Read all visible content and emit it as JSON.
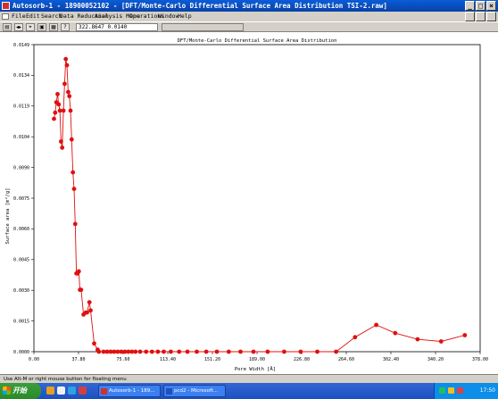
{
  "window": {
    "title": "Autosorb-1 - 18900052102 - [DFT/Monte-Carlo Differential Surface Area Distribution TSI-2.raw]",
    "controls": {
      "minimize": "_",
      "maximize": "□",
      "close": "×"
    }
  },
  "menu": {
    "items": [
      "File",
      "Edit",
      "Search",
      "Data Reduction",
      "Analysis Menu",
      "Operations",
      "Window",
      "Help"
    ]
  },
  "toolbar": {
    "coordinate_readout": "322.8647  0.0140",
    "help_glyph": "?"
  },
  "statusbar": {
    "text": "Use Alt-M or right mouse button for floating menu"
  },
  "taskbar": {
    "start_label": "开始",
    "tasks": [
      "Autosorb-1 - 189...",
      "pcd2 - Microsoft..."
    ],
    "clock": "17:50"
  },
  "colors": {
    "series": "#e01010",
    "titlebar": "#0842a8",
    "taskbar": "#2a5fd0"
  },
  "chart_data": {
    "type": "line",
    "title": "DFT/Monte-Carlo Differential Surface Area Distribution",
    "xlabel": "Pore Width [Å]",
    "ylabel": "Surface area [m²/g]",
    "xlim": [
      0,
      378
    ],
    "ylim": [
      0,
      0.0149
    ],
    "x_ticks": [
      "0.00",
      "37.80",
      "75.60",
      "113.40",
      "151.20",
      "189.00",
      "226.80",
      "264.60",
      "302.40",
      "340.20",
      "378.00"
    ],
    "y_ticks": [
      "0.0000",
      "0.0015",
      "0.0030",
      "0.0045",
      "0.0060",
      "0.0075",
      "0.0090",
      "0.0104",
      "0.0119",
      "0.0134",
      "0.0149"
    ],
    "grid": false,
    "series": [
      {
        "x": [
          17,
          18,
          19,
          20,
          21,
          22,
          23,
          24,
          25,
          26,
          27,
          28,
          29,
          30,
          31,
          32,
          33,
          34,
          35,
          36,
          37,
          38,
          39,
          40,
          42,
          44,
          45,
          47,
          48,
          51,
          54,
          55,
          59,
          62,
          65,
          68,
          71,
          74,
          77,
          80,
          83,
          86,
          90,
          95,
          100,
          105,
          110,
          116,
          123,
          130,
          138,
          146,
          155,
          165,
          175,
          186,
          198,
          212,
          226,
          240,
          256,
          272,
          290,
          306,
          325,
          345,
          365
        ],
        "y": [
          0.0113,
          0.0116,
          0.0121,
          0.0125,
          0.012,
          0.0117,
          0.0102,
          0.0099,
          0.0117,
          0.013,
          0.0142,
          0.0139,
          0.0126,
          0.0124,
          0.0117,
          0.0103,
          0.0087,
          0.0079,
          0.0062,
          0.0038,
          0.0038,
          0.0039,
          0.003,
          0.003,
          0.0018,
          0.0019,
          0.0019,
          0.0024,
          0.002,
          0.0004,
          0.0001,
          0.0,
          0.0,
          0.0,
          0.0,
          0.0,
          0.0,
          0.0,
          0.0,
          0.0,
          0.0,
          0.0,
          0.0,
          0.0,
          0.0,
          0.0,
          0.0,
          0.0,
          0.0,
          0.0,
          0.0,
          0.0,
          0.0,
          0.0,
          0.0,
          0.0,
          0.0,
          0.0,
          0.0,
          0.0,
          0.0,
          0.0007,
          0.0013,
          0.0009,
          0.0006,
          0.0005,
          0.0008
        ]
      }
    ]
  }
}
